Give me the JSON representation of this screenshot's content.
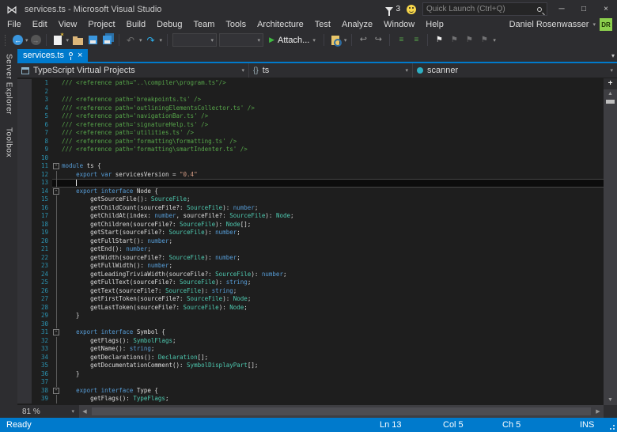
{
  "titlebar": {
    "title": "services.ts - Microsoft Visual Studio",
    "notification_count": "3",
    "quick_launch_placeholder": "Quick Launch (Ctrl+Q)"
  },
  "menu": {
    "items": [
      "File",
      "Edit",
      "View",
      "Project",
      "Build",
      "Debug",
      "Team",
      "Tools",
      "Architecture",
      "Test",
      "Analyze",
      "Window",
      "Help"
    ],
    "user_name": "Daniel Rosenwasser",
    "user_initials": "DR"
  },
  "toolbar": {
    "attach_label": "Attach..."
  },
  "side_tabs": [
    "Server Explorer",
    "Toolbox"
  ],
  "tabs": [
    {
      "label": "services.ts"
    }
  ],
  "navbar": {
    "project_selector": "TypeScript Virtual Projects",
    "type_selector": "ts",
    "type_icon": "{}",
    "member_selector": "scanner"
  },
  "editor": {
    "zoom_level": "81 %",
    "lines": [
      {
        "n": 1,
        "fold": "none",
        "segs": [
          [
            "com",
            "/// <reference path=\"..\\compiler\\program.ts\"/>"
          ]
        ]
      },
      {
        "n": 2,
        "fold": "none",
        "segs": []
      },
      {
        "n": 3,
        "fold": "none",
        "segs": [
          [
            "com",
            "/// <reference path='breakpoints.ts' />"
          ]
        ]
      },
      {
        "n": 4,
        "fold": "none",
        "segs": [
          [
            "com",
            "/// <reference path='outliningElementsCollector.ts' />"
          ]
        ]
      },
      {
        "n": 5,
        "fold": "none",
        "segs": [
          [
            "com",
            "/// <reference path='navigationBar.ts' />"
          ]
        ]
      },
      {
        "n": 6,
        "fold": "none",
        "segs": [
          [
            "com",
            "/// <reference path='signatureHelp.ts' />"
          ]
        ]
      },
      {
        "n": 7,
        "fold": "none",
        "segs": [
          [
            "com",
            "/// <reference path='utilities.ts' />"
          ]
        ]
      },
      {
        "n": 8,
        "fold": "none",
        "segs": [
          [
            "com",
            "/// <reference path='formatting\\formatting.ts' />"
          ]
        ]
      },
      {
        "n": 9,
        "fold": "none",
        "segs": [
          [
            "com",
            "/// <reference path='formatting\\smartIndenter.ts' />"
          ]
        ]
      },
      {
        "n": 10,
        "fold": "none",
        "segs": []
      },
      {
        "n": 11,
        "fold": "box",
        "segs": [
          [
            "kw",
            "module"
          ],
          [
            "pl",
            " ts {"
          ]
        ]
      },
      {
        "n": 12,
        "fold": "line",
        "segs": [
          [
            "pl",
            "    "
          ],
          [
            "kw",
            "export"
          ],
          [
            "pl",
            " "
          ],
          [
            "kw",
            "var"
          ],
          [
            "pl",
            " servicesVersion = "
          ],
          [
            "str",
            "\"0.4\""
          ]
        ]
      },
      {
        "n": 13,
        "fold": "line",
        "cur": true,
        "segs": [
          [
            "pl",
            "    "
          ]
        ]
      },
      {
        "n": 14,
        "fold": "box",
        "segs": [
          [
            "pl",
            "    "
          ],
          [
            "kw",
            "export"
          ],
          [
            "pl",
            " "
          ],
          [
            "kw",
            "interface"
          ],
          [
            "pl",
            " Node {"
          ]
        ]
      },
      {
        "n": 15,
        "fold": "line",
        "segs": [
          [
            "pl",
            "        getSourceFile(): "
          ],
          [
            "ty",
            "SourceFile"
          ],
          [
            "pl",
            ";"
          ]
        ]
      },
      {
        "n": 16,
        "fold": "line",
        "segs": [
          [
            "pl",
            "        getChildCount(sourceFile?: "
          ],
          [
            "ty",
            "SourceFile"
          ],
          [
            "pl",
            "): "
          ],
          [
            "kw",
            "number"
          ],
          [
            "pl",
            ";"
          ]
        ]
      },
      {
        "n": 17,
        "fold": "line",
        "segs": [
          [
            "pl",
            "        getChildAt(index: "
          ],
          [
            "kw",
            "number"
          ],
          [
            "pl",
            ", sourceFile?: "
          ],
          [
            "ty",
            "SourceFile"
          ],
          [
            "pl",
            "): "
          ],
          [
            "ty",
            "Node"
          ],
          [
            "pl",
            ";"
          ]
        ]
      },
      {
        "n": 18,
        "fold": "line",
        "segs": [
          [
            "pl",
            "        getChildren(sourceFile?: "
          ],
          [
            "ty",
            "SourceFile"
          ],
          [
            "pl",
            "): "
          ],
          [
            "ty",
            "Node"
          ],
          [
            "pl",
            "[];"
          ]
        ]
      },
      {
        "n": 19,
        "fold": "line",
        "segs": [
          [
            "pl",
            "        getStart(sourceFile?: "
          ],
          [
            "ty",
            "SourceFile"
          ],
          [
            "pl",
            "): "
          ],
          [
            "kw",
            "number"
          ],
          [
            "pl",
            ";"
          ]
        ]
      },
      {
        "n": 20,
        "fold": "line",
        "segs": [
          [
            "pl",
            "        getFullStart(): "
          ],
          [
            "kw",
            "number"
          ],
          [
            "pl",
            ";"
          ]
        ]
      },
      {
        "n": 21,
        "fold": "line",
        "segs": [
          [
            "pl",
            "        getEnd(): "
          ],
          [
            "kw",
            "number"
          ],
          [
            "pl",
            ";"
          ]
        ]
      },
      {
        "n": 22,
        "fold": "line",
        "segs": [
          [
            "pl",
            "        getWidth(sourceFile?: "
          ],
          [
            "ty",
            "SourceFile"
          ],
          [
            "pl",
            "): "
          ],
          [
            "kw",
            "number"
          ],
          [
            "pl",
            ";"
          ]
        ]
      },
      {
        "n": 23,
        "fold": "line",
        "segs": [
          [
            "pl",
            "        getFullWidth(): "
          ],
          [
            "kw",
            "number"
          ],
          [
            "pl",
            ";"
          ]
        ]
      },
      {
        "n": 24,
        "fold": "line",
        "segs": [
          [
            "pl",
            "        getLeadingTriviaWidth(sourceFile?: "
          ],
          [
            "ty",
            "SourceFile"
          ],
          [
            "pl",
            "): "
          ],
          [
            "kw",
            "number"
          ],
          [
            "pl",
            ";"
          ]
        ]
      },
      {
        "n": 25,
        "fold": "line",
        "segs": [
          [
            "pl",
            "        getFullText(sourceFile?: "
          ],
          [
            "ty",
            "SourceFile"
          ],
          [
            "pl",
            "): "
          ],
          [
            "kw",
            "string"
          ],
          [
            "pl",
            ";"
          ]
        ]
      },
      {
        "n": 26,
        "fold": "line",
        "segs": [
          [
            "pl",
            "        getText(sourceFile?: "
          ],
          [
            "ty",
            "SourceFile"
          ],
          [
            "pl",
            "): "
          ],
          [
            "kw",
            "string"
          ],
          [
            "pl",
            ";"
          ]
        ]
      },
      {
        "n": 27,
        "fold": "line",
        "segs": [
          [
            "pl",
            "        getFirstToken(sourceFile?: "
          ],
          [
            "ty",
            "SourceFile"
          ],
          [
            "pl",
            "): "
          ],
          [
            "ty",
            "Node"
          ],
          [
            "pl",
            ";"
          ]
        ]
      },
      {
        "n": 28,
        "fold": "line",
        "segs": [
          [
            "pl",
            "        getLastToken(sourceFile?: "
          ],
          [
            "ty",
            "SourceFile"
          ],
          [
            "pl",
            "): "
          ],
          [
            "ty",
            "Node"
          ],
          [
            "pl",
            ";"
          ]
        ]
      },
      {
        "n": 29,
        "fold": "line",
        "segs": [
          [
            "pl",
            "    }"
          ]
        ]
      },
      {
        "n": 30,
        "fold": "line",
        "segs": []
      },
      {
        "n": 31,
        "fold": "box",
        "segs": [
          [
            "pl",
            "    "
          ],
          [
            "kw",
            "export"
          ],
          [
            "pl",
            " "
          ],
          [
            "kw",
            "interface"
          ],
          [
            "pl",
            " Symbol {"
          ]
        ]
      },
      {
        "n": 32,
        "fold": "line",
        "segs": [
          [
            "pl",
            "        getFlags(): "
          ],
          [
            "ty",
            "SymbolFlags"
          ],
          [
            "pl",
            ";"
          ]
        ]
      },
      {
        "n": 33,
        "fold": "line",
        "segs": [
          [
            "pl",
            "        getName(): "
          ],
          [
            "kw",
            "string"
          ],
          [
            "pl",
            ";"
          ]
        ]
      },
      {
        "n": 34,
        "fold": "line",
        "segs": [
          [
            "pl",
            "        getDeclarations(): "
          ],
          [
            "ty",
            "Declaration"
          ],
          [
            "pl",
            "[];"
          ]
        ]
      },
      {
        "n": 35,
        "fold": "line",
        "segs": [
          [
            "pl",
            "        getDocumentationComment(): "
          ],
          [
            "ty",
            "SymbolDisplayPart"
          ],
          [
            "pl",
            "[];"
          ]
        ]
      },
      {
        "n": 36,
        "fold": "line",
        "segs": [
          [
            "pl",
            "    }"
          ]
        ]
      },
      {
        "n": 37,
        "fold": "line",
        "segs": []
      },
      {
        "n": 38,
        "fold": "box",
        "segs": [
          [
            "pl",
            "    "
          ],
          [
            "kw",
            "export"
          ],
          [
            "pl",
            " "
          ],
          [
            "kw",
            "interface"
          ],
          [
            "pl",
            " Type {"
          ]
        ]
      },
      {
        "n": 39,
        "fold": "line",
        "segs": [
          [
            "pl",
            "        getFlags(): "
          ],
          [
            "ty",
            "TypeFlags"
          ],
          [
            "pl",
            ";"
          ]
        ]
      }
    ]
  },
  "statusbar": {
    "state": "Ready",
    "line": "Ln 13",
    "column": "Col 5",
    "character": "Ch 5",
    "mode": "INS"
  },
  "icons": {
    "logo": "⋈",
    "minimize": "─",
    "maximize": "□",
    "close": "×",
    "back": "←",
    "forward": "→",
    "undo": "↶",
    "redo": "↷",
    "play": "▶",
    "caret_down": "▾",
    "bookmark_flag": "⚑",
    "nav_return": "↩",
    "nav_goto": "↪",
    "comment_lines": "≡",
    "arrow_up": "▲",
    "arrow_down": "▼",
    "arrow_left": "◀",
    "arrow_right": "▶",
    "split_cross": "+",
    "fold_collapse": "-"
  },
  "colors": {
    "accent": "#007acc",
    "shell_bg": "#2d2d30",
    "editor_bg": "#1e1e1e",
    "keyword": "#569cd6",
    "type": "#4ec9b0",
    "string": "#d69d85",
    "comment": "#57a64a",
    "line_number": "#2b91af",
    "avatar_bg": "#8ccf4d"
  }
}
